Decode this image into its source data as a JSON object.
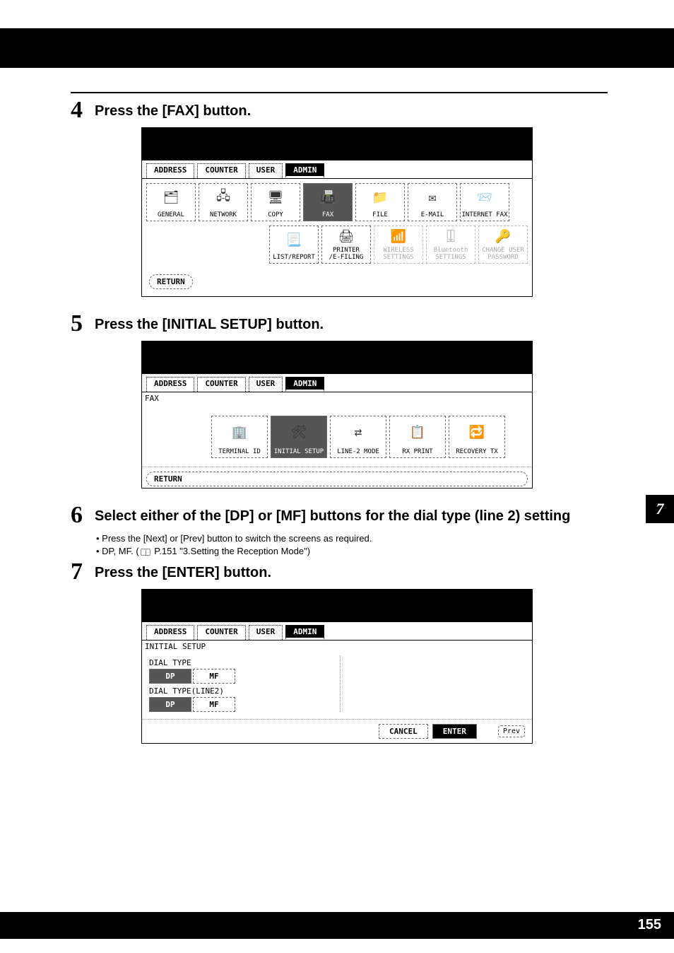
{
  "steps": {
    "s4": {
      "num": "4",
      "title": "Press the [FAX] button."
    },
    "s5": {
      "num": "5",
      "title": "Press the [INITIAL SETUP] button."
    },
    "s6": {
      "num": "6",
      "title": "Select either of the [DP] or [MF] buttons for the dial type (line 2) setting",
      "bullet1": "Press the [Next] or [Prev] button to switch the screens as required.",
      "bullet2_prefix": "DP, MF. (",
      "bullet2_ref": "P.151 \"3.Setting the Reception Mode\")"
    },
    "s7": {
      "num": "7",
      "title": "Press the [ENTER] button."
    }
  },
  "tabs": {
    "address": "ADDRESS",
    "counter": "COUNTER",
    "user": "USER",
    "admin": "ADMIN"
  },
  "ss1": {
    "btns": {
      "general": "GENERAL",
      "network": "NETWORK",
      "copy": "COPY",
      "fax": "FAX",
      "file": "FILE",
      "email": "E-MAIL",
      "ifax": "INTERNET FAX",
      "list": "LIST/REPORT",
      "printer": "PRINTER\n/E-FILING",
      "wireless": "WIRELESS\nSETTINGS",
      "bt": "Bluetooth\nSETTINGS",
      "pwd": "CHANGE USER\nPASSWORD"
    },
    "return_label": "RETURN"
  },
  "ss2": {
    "title": "FAX",
    "btns": {
      "terminal": "TERMINAL ID",
      "initial": "INITIAL SETUP",
      "line2": "LINE-2 MODE",
      "rxprint": "RX PRINT",
      "recovery": "RECOVERY TX"
    },
    "return_label": "RETURN"
  },
  "ss3": {
    "title": "INITIAL SETUP",
    "dial_type_label": "DIAL TYPE",
    "dial_type2_label": "DIAL TYPE(LINE2)",
    "dp": "DP",
    "mf": "MF",
    "cancel": "CANCEL",
    "enter": "ENTER",
    "prev": "Prev"
  },
  "side_tab": "7",
  "page_number": "155"
}
